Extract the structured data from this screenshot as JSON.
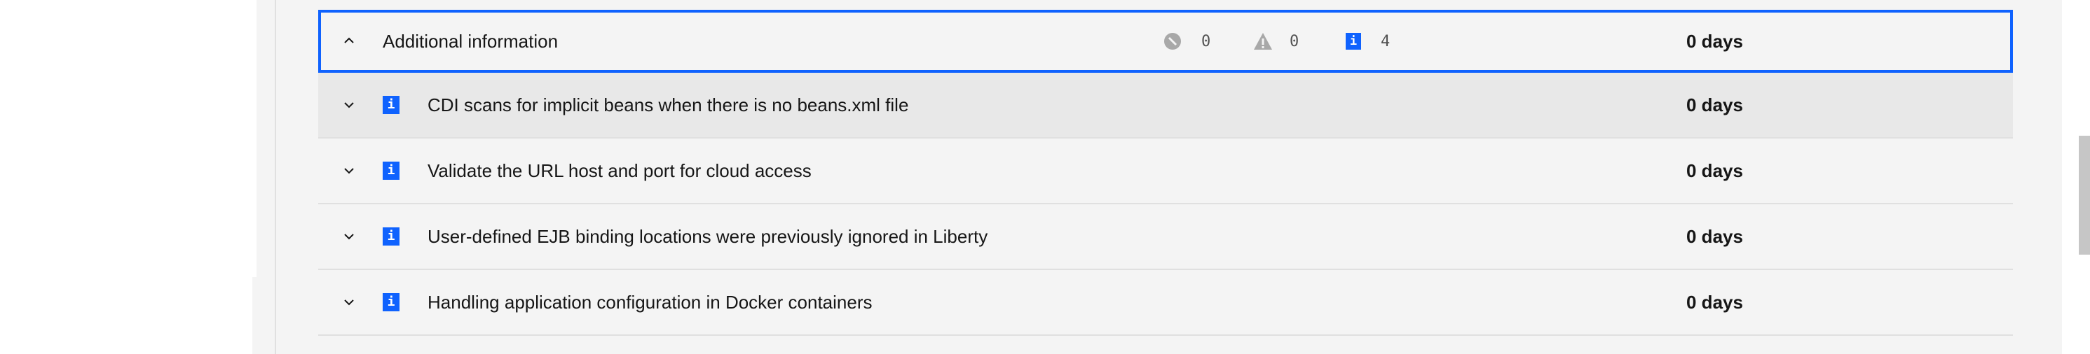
{
  "group": {
    "title": "Additional information",
    "critical_count": "0",
    "warning_count": "0",
    "info_count": "4",
    "days": "0 days",
    "expanded": true
  },
  "rows": [
    {
      "icon": "info-icon",
      "glyph": "i",
      "title": "CDI scans for implicit beans when there is no beans.xml file",
      "days": "0 days"
    },
    {
      "icon": "info-icon",
      "glyph": "i",
      "title": "Validate the URL host and port for cloud access",
      "days": "0 days"
    },
    {
      "icon": "info-icon",
      "glyph": "i",
      "title": "User-defined EJB binding locations were previously ignored in Liberty",
      "days": "0 days"
    },
    {
      "icon": "info-icon",
      "glyph": "i",
      "title": "Handling application configuration in Docker containers",
      "days": "0 days"
    }
  ],
  "colors": {
    "accent": "#0f62fe",
    "critical_icon": "#a8a8a8",
    "warning_icon": "#a8a8a8"
  }
}
